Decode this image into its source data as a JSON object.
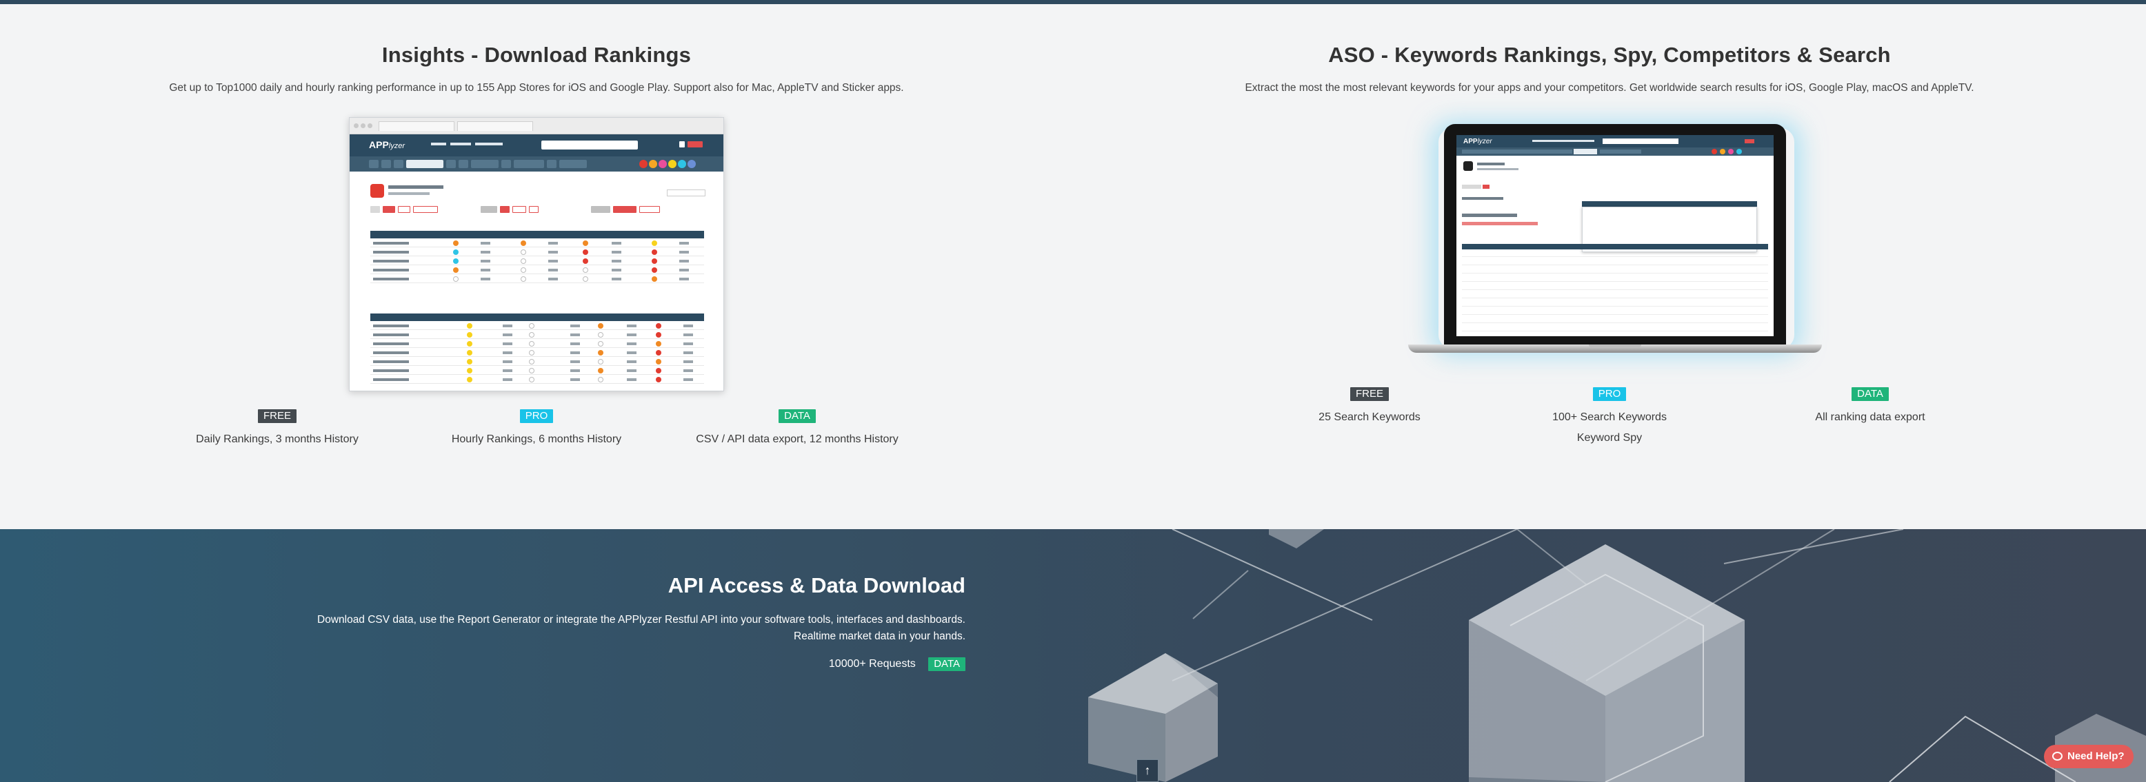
{
  "insights": {
    "title": "Insights - Download Rankings",
    "description": "Get up to Top1000 daily and hourly ranking performance in up to 155 App Stores for iOS and Google Play. Support also for Mac, AppleTV and Sticker apps.",
    "tiers": [
      {
        "badge": "FREE",
        "text": "Daily Rankings, 3 months History"
      },
      {
        "badge": "PRO",
        "text": "Hourly Rankings, 6 months History"
      },
      {
        "badge": "DATA",
        "text": "CSV / API data export, 12 months History"
      }
    ]
  },
  "aso": {
    "title": "ASO - Keywords Rankings, Spy, Competitors & Search",
    "description": "Extract the most the most relevant keywords for your apps and your competitors. Get worldwide search results for iOS, Google Play, macOS and AppleTV.",
    "tiers": [
      {
        "badge": "FREE",
        "text": "25 Search Keywords",
        "text2": ""
      },
      {
        "badge": "PRO",
        "text": "100+ Search Keywords",
        "text2": "Keyword Spy"
      },
      {
        "badge": "DATA",
        "text": "All ranking data export",
        "text2": ""
      }
    ]
  },
  "api": {
    "title": "API Access & Data Download",
    "description": "Download CSV data, use the Report Generator or integrate the APPlyzer Restful API into your software tools, interfaces and dashboards. Realtime market data in your hands.",
    "requests_label": "10000+ Requests",
    "requests_badge": "DATA"
  },
  "help_button": "Need Help?",
  "colors": {
    "free": "#444a4f",
    "pro": "#19c3e8",
    "data": "#1fb47a",
    "help": "#e45b59"
  }
}
